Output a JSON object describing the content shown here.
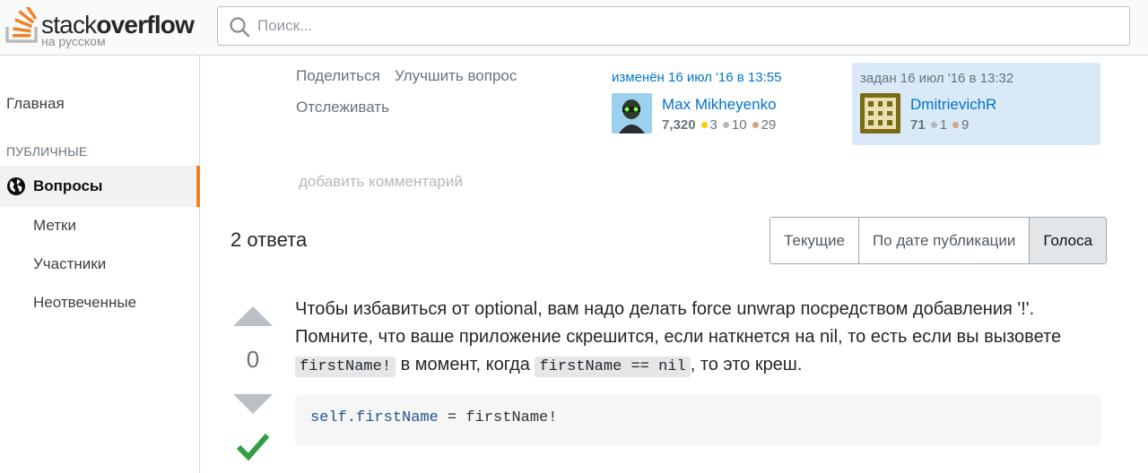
{
  "logo": {
    "text_light": "stack",
    "text_bold": "overflow",
    "subtitle": "на русском"
  },
  "search": {
    "placeholder": "Поиск..."
  },
  "sidebar": {
    "home": "Главная",
    "section": "ПУБЛИЧНЫЕ",
    "active_item": "Вопросы",
    "sub_items": [
      "Метки",
      "Участники",
      "Неотвеченные"
    ]
  },
  "question_footer": {
    "share": "Поделиться",
    "improve": "Улучшить вопрос",
    "follow": "Отслеживать",
    "edited": {
      "label": "изменён 16 июл '16 в 13:55",
      "user": "Max Mikheyenko",
      "reputation": "7,320",
      "gold": "3",
      "silver": "10",
      "bronze": "29"
    },
    "asked": {
      "label": "задан 16 июл '16 в 13:32",
      "user": "DmitrievichR",
      "reputation": "71",
      "silver": "1",
      "bronze": "9"
    },
    "add_comment": "добавить комментарий"
  },
  "answers": {
    "count_label": "2 ответа",
    "tabs": [
      "Текущие",
      "По дате публикации",
      "Голоса"
    ],
    "active_tab": "Голоса"
  },
  "answer": {
    "votes": "0",
    "text_1": "Чтобы избавиться от optional, вам надо делать force unwrap посредством добавления '!'. Помните, что ваше приложение скрешится, если наткнется на nil, то есть если вы вызовете ",
    "code_1": "firstName!",
    "text_2": " в момент, когда ",
    "code_2": "firstName == nil",
    "text_3": ", то это креш.",
    "code_block_kw": "self.firstName",
    "code_block_rest": " = firstName!"
  },
  "colors": {
    "accent": "#f48024",
    "link": "#0074cc",
    "accepted": "#2f9e44",
    "gold": "#ffcc01",
    "silver": "#b4b8bc",
    "bronze": "#d1a684"
  }
}
